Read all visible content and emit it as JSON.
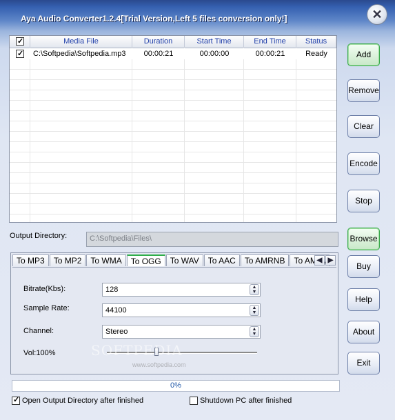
{
  "window": {
    "title": "Aya Audio Converter1.2.4[Trial Version,Left 5 files conversion only!]",
    "close_symbol": "✕"
  },
  "list": {
    "columns": [
      "Media File",
      "Duration",
      "Start Time",
      "End Time",
      "Status"
    ],
    "header_checked": true,
    "rows": [
      {
        "checked": true,
        "file": "C:\\Softpedia\\Softpedia.mp3",
        "duration": "00:00:21",
        "start": "00:00:00",
        "end": "00:00:21",
        "status": "Ready"
      }
    ]
  },
  "output": {
    "label": "Output Directory:",
    "value": "C:\\Softpedia\\Files\\"
  },
  "tabs": {
    "items": [
      "To MP3",
      "To MP2",
      "To WMA",
      "To OGG",
      "To WAV",
      "To AAC",
      "To AMRNB",
      "To AMRWB"
    ],
    "active_index": 3,
    "prev_symbol": "◀",
    "next_symbol": "▶"
  },
  "settings": {
    "bitrate_label": "Bitrate(Kbs):",
    "bitrate_value": "128",
    "samplerate_label": "Sample Rate:",
    "samplerate_value": "44100",
    "channel_label": "Channel:",
    "channel_value": "Stereo",
    "volume_label": "Vol:100%",
    "volume_level": 0.33
  },
  "progress": {
    "text": "0%",
    "value": 0
  },
  "options": {
    "open_output_label": "Open Output Directory after finished",
    "open_output_checked": true,
    "shutdown_label": "Shutdown PC after finished",
    "shutdown_checked": false
  },
  "buttons": {
    "add": "Add",
    "remove": "Remove",
    "clear": "Clear",
    "encode": "Encode",
    "stop": "Stop",
    "browse": "Browse",
    "buy": "Buy",
    "help": "Help",
    "about": "About",
    "exit": "Exit"
  },
  "watermark": {
    "text": "SOFTPEDIA",
    "url": "www.softpedia.com"
  }
}
